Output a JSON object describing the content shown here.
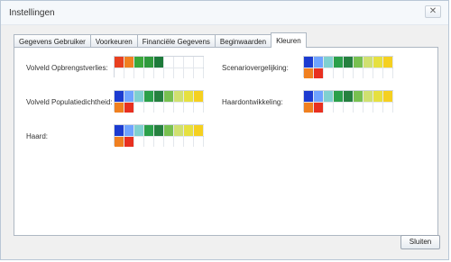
{
  "window": {
    "title": "Instellingen",
    "close_glyph": "✕"
  },
  "tabs": [
    {
      "label": "Gegevens Gebruiker",
      "active": false
    },
    {
      "label": "Voorkeuren",
      "active": false
    },
    {
      "label": "Financiële Gegevens",
      "active": false
    },
    {
      "label": "Beginwaarden",
      "active": false
    },
    {
      "label": "Kleuren",
      "active": true
    }
  ],
  "colors": {
    "left_column": [
      {
        "label": "Volveld Opbrengstverlies:",
        "top": [
          "#e84020",
          "#f08020",
          "#3aa83a",
          "#2f9a3c",
          "#1d7a3a",
          "#ffffff",
          "#ffffff",
          "#ffffff",
          "#ffffff"
        ],
        "bottom": [
          "#ffffff",
          "#ffffff",
          "#ffffff",
          "#ffffff",
          "#ffffff",
          "#ffffff",
          "#ffffff",
          "#ffffff",
          "#ffffff"
        ]
      },
      {
        "label": "Volveld Populatiedichtheid:",
        "top": [
          "#1c3bd0",
          "#6fa3ff",
          "#7fd0d0",
          "#2ba04a",
          "#25803f",
          "#78c050",
          "#d0e070",
          "#e6e040",
          "#f5d020"
        ],
        "bottom": [
          "#f08020",
          "#e83020",
          "#ffffff",
          "#ffffff",
          "#ffffff",
          "#ffffff",
          "#ffffff",
          "#ffffff",
          "#ffffff"
        ]
      },
      {
        "label": "Haard:",
        "top": [
          "#1c3bd0",
          "#6fa3ff",
          "#7fd0d0",
          "#2ba04a",
          "#25803f",
          "#78c050",
          "#d0e070",
          "#e6e040",
          "#f5d020"
        ],
        "bottom": [
          "#f08020",
          "#e83020",
          "#ffffff",
          "#ffffff",
          "#ffffff",
          "#ffffff",
          "#ffffff",
          "#ffffff",
          "#ffffff"
        ]
      }
    ],
    "right_column": [
      {
        "label": "Scenariovergelijking:",
        "top": [
          "#1c3bd0",
          "#6fa3ff",
          "#7fd0d0",
          "#2ba04a",
          "#25803f",
          "#78c050",
          "#d0e070",
          "#e6e040",
          "#f5d020"
        ],
        "bottom": [
          "#f08020",
          "#e83020",
          "#ffffff",
          "#ffffff",
          "#ffffff",
          "#ffffff",
          "#ffffff",
          "#ffffff",
          "#ffffff"
        ]
      },
      {
        "label": "Haardontwikkeling:",
        "top": [
          "#1c3bd0",
          "#6fa3ff",
          "#7fd0d0",
          "#2ba04a",
          "#25803f",
          "#78c050",
          "#d0e070",
          "#e6e040",
          "#f5d020"
        ],
        "bottom": [
          "#f08020",
          "#e83020",
          "#ffffff",
          "#ffffff",
          "#ffffff",
          "#ffffff",
          "#ffffff",
          "#ffffff",
          "#ffffff"
        ]
      }
    ]
  },
  "buttons": {
    "close_label": "Sluiten"
  }
}
